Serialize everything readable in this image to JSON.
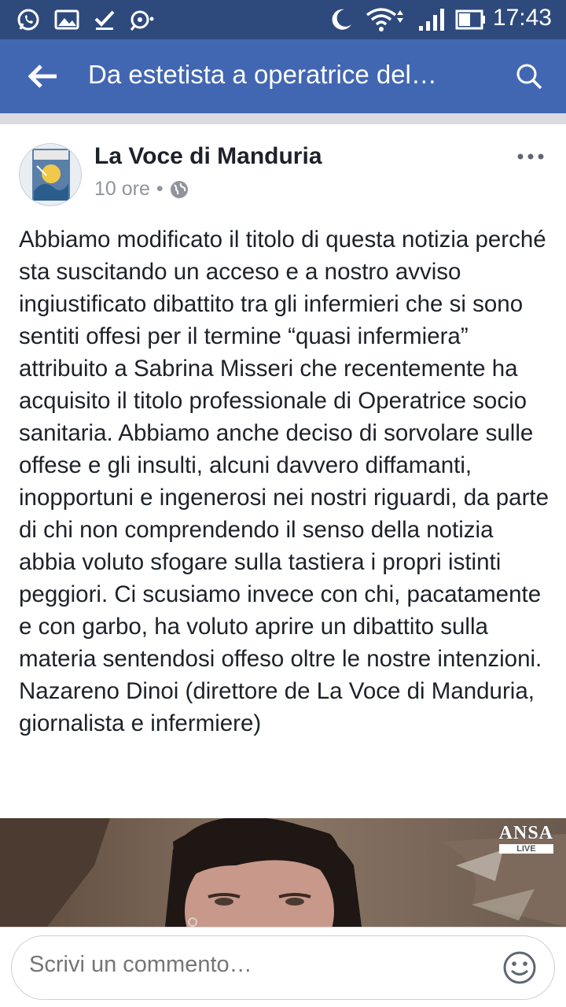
{
  "status_bar": {
    "time": "17:43",
    "icons": [
      "whatsapp-icon",
      "gallery-icon",
      "check-icon",
      "sync-icon",
      "moon-icon",
      "wifi-icon",
      "signal-icon",
      "battery-icon"
    ]
  },
  "app_bar": {
    "title": "Da estetista a operatrice del…",
    "back_icon": "arrow-left-icon",
    "search_icon": "search-icon"
  },
  "post": {
    "author": "La Voce di Manduria",
    "time": "10 ore",
    "separator": "•",
    "privacy_icon": "globe-icon",
    "text": "Abbiamo modificato il titolo di questa notizia perché sta suscitando un acceso e a nostro avviso ingiustificato dibattito tra gli infermieri che si sono sentiti offesi per il termine “quasi infermiera” attribuito a Sabrina Misseri che recentemente ha acquisito il titolo professionale di Operatrice socio sanitaria. Abbiamo anche deciso di sorvolare sulle offese e gli insulti, alcuni davvero diffamanti, inopportuni e ingenerosi nei nostri riguardi, da parte di chi non comprendendo il senso della notizia abbia voluto sfogare sulla tastiera i propri istinti peggiori. Ci scusiamo invece con chi, pacatamente e con garbo, ha voluto aprire un dibattito sulla materia sentendosi offeso oltre le nostre intenzioni.\nNazareno Dinoi (direttore de La Voce di Manduria, giornalista e infermiere)",
    "photo_watermark": "ANSA",
    "photo_watermark_sub": "LIVE"
  },
  "comment": {
    "placeholder": "Scrivi un commento…",
    "emoji_icon": "smiley-icon"
  }
}
